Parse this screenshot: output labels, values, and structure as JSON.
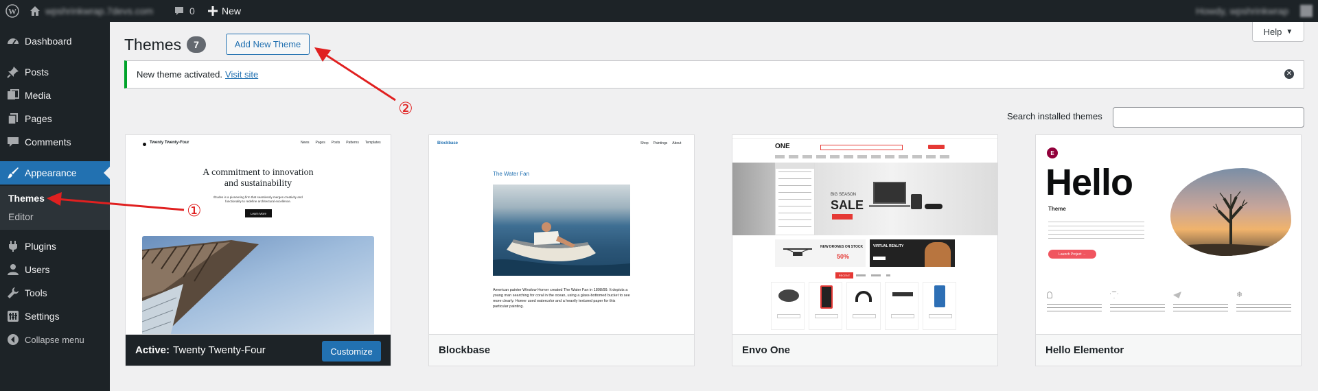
{
  "admin_bar": {
    "site_name": "wpshrinkwrap.7devs.com",
    "comments_count": "0",
    "new_label": "New",
    "howdy": "Howdy, wpshrinkwrap"
  },
  "sidebar": {
    "items": [
      {
        "label": "Dashboard",
        "icon": "dashboard-icon"
      },
      {
        "label": "Posts",
        "icon": "pin-icon"
      },
      {
        "label": "Media",
        "icon": "media-icon"
      },
      {
        "label": "Pages",
        "icon": "pages-icon"
      },
      {
        "label": "Comments",
        "icon": "comments-icon"
      },
      {
        "label": "Appearance",
        "icon": "paintbrush-icon"
      },
      {
        "label": "Plugins",
        "icon": "plugin-icon"
      },
      {
        "label": "Users",
        "icon": "users-icon"
      },
      {
        "label": "Tools",
        "icon": "wrench-icon"
      },
      {
        "label": "Settings",
        "icon": "settings-icon"
      },
      {
        "label": "Collapse menu",
        "icon": "collapse-icon"
      }
    ],
    "appearance_submenu": [
      "Themes",
      "Editor"
    ]
  },
  "page": {
    "help_label": "Help",
    "title": "Themes",
    "count": "7",
    "add_new_label": "Add New Theme",
    "notice_text": "New theme activated.",
    "notice_link": "Visit site",
    "search_label": "Search installed themes"
  },
  "annotations": {
    "one": "①",
    "two": "②"
  },
  "themes": [
    {
      "name": "Twenty Twenty-Four",
      "active_prefix": "Active:",
      "customize_label": "Customize",
      "preview": {
        "site_title": "Twenty Twenty-Four",
        "nav": [
          "News",
          "Pages",
          "Posts",
          "Patterns",
          "Templates"
        ],
        "headline1": "A commitment to innovation",
        "headline2": "and sustainability",
        "body": "Études is a pioneering firm that seamlessly merges creativity and functionality to redefine architectural excellence.",
        "button": "Learn More"
      }
    },
    {
      "name": "Blockbase",
      "preview": {
        "site_title": "Blockbase",
        "nav": [
          "Shop",
          "Paintings",
          "About"
        ],
        "post_title": "The Water Fan",
        "caption": "American painter Winslow Homer created The Water Fan in 1898/99. It depicts a young man searching for coral in the ocean, using a glass-bottomed bucket to see more clearly. Homer used watercolor and a heavily textured paper for this particular painting."
      }
    },
    {
      "name": "Envo One",
      "preview": {
        "logo": "ONE",
        "sale_small": "BIG SEASON",
        "sale_big": "SALE",
        "drones": "NEW DRONES ON STOCK",
        "vr": "VIRTUAL REALITY",
        "percent": "50%",
        "tab": "RECENT"
      }
    },
    {
      "name": "Hello Elementor",
      "preview": {
        "logo": "E",
        "hello": "Hello",
        "sub": "Theme",
        "cta": "Launch Project →"
      }
    }
  ],
  "colors": {
    "admin_bar": "#1d2327",
    "accent": "#2271b1",
    "notice_success": "#00a32a",
    "annotation": "#e02020"
  }
}
